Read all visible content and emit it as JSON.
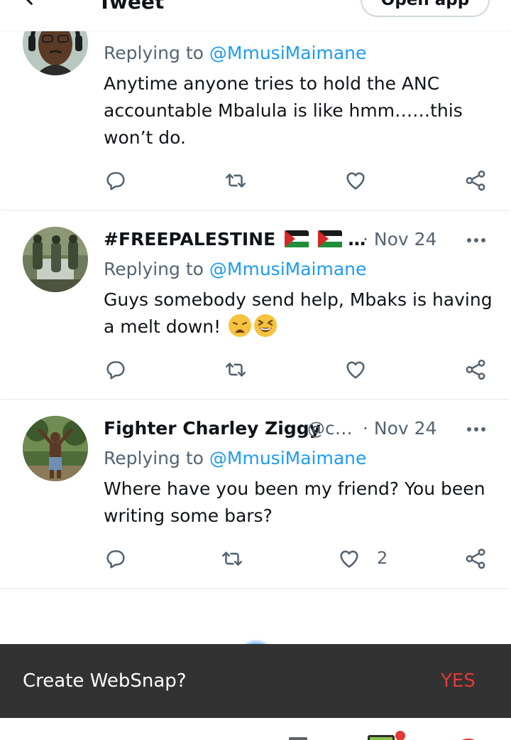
{
  "header": {
    "title": "Tweet",
    "open_app_label": "Open app"
  },
  "tweets": [
    {
      "replying_prefix": "Replying to",
      "replying_to": "@MmusiMaimane",
      "text": "Anytime anyone tries to hold the ANC accountable Mbalula is like hmm……this won’t do.",
      "likes": ""
    },
    {
      "name": "#FREEPALESTINE",
      "name_suffix": "…",
      "date": "· Nov 24",
      "replying_prefix": "Replying to",
      "replying_to": "@MmusiMaimane",
      "text": "Guys somebody send help, Mbaks is having a melt down!",
      "emojis": [
        "weary-face",
        "grinning-squinting-face"
      ],
      "likes": ""
    },
    {
      "name": "Fighter Charley Ziggy",
      "handle": "@c…",
      "date": "· Nov 24",
      "replying_prefix": "Replying to",
      "replying_to": "@MmusiMaimane",
      "text": "Where have you been my friend? You been writing some bars?",
      "likes": "2"
    }
  ],
  "websnap": {
    "prompt": "Create WebSnap?",
    "action": "YES",
    "action_color": "#e53935"
  },
  "colors": {
    "link": "#1d9bf0",
    "secondary_text": "#536471",
    "divider": "#eff3f4"
  }
}
